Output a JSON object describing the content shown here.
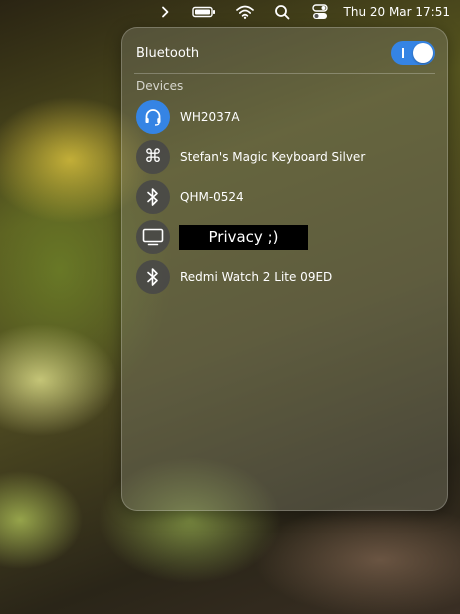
{
  "topbar": {
    "chevron_icon": "chevron-right-icon",
    "battery_icon": "battery-icon",
    "wifi_icon": "wifi-icon",
    "search_icon": "search-icon",
    "settings_icon": "toggles-icon",
    "clock": "Thu 20 Mar 17:51"
  },
  "bluetooth": {
    "title": "Bluetooth",
    "enabled": true,
    "accent": "#3584e4"
  },
  "devices_label": "Devices",
  "devices": [
    {
      "name": "WH2037A",
      "icon": "headset-icon",
      "active": true
    },
    {
      "name": "Stefan's Magic Keyboard Silver",
      "icon": "command-key-icon",
      "active": false
    },
    {
      "name": "QHM-0524",
      "icon": "bluetooth-icon",
      "active": false
    },
    {
      "name": "Privacy ;)",
      "icon": "monitor-icon",
      "active": false,
      "redacted": true
    },
    {
      "name": "Redmi Watch 2 Lite 09ED",
      "icon": "bluetooth-icon",
      "active": false
    }
  ]
}
